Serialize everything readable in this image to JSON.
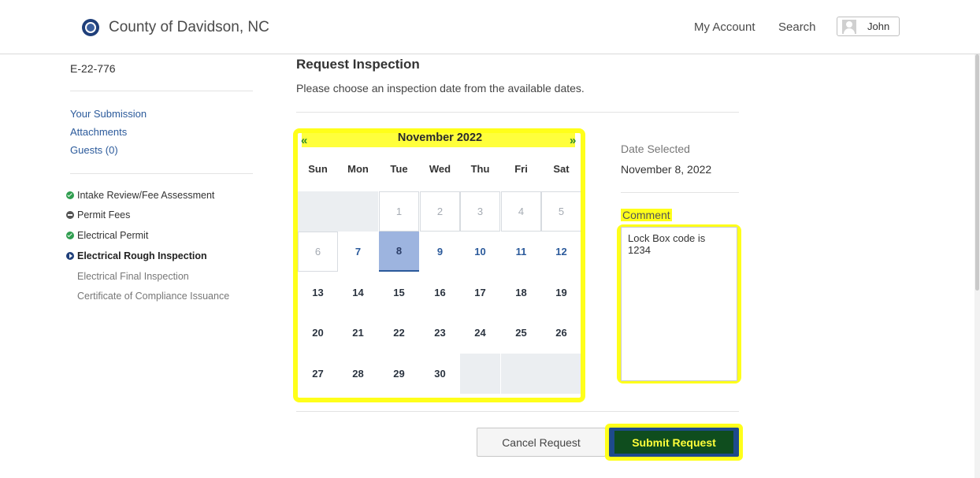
{
  "header": {
    "brand": "County of Davidson, NC",
    "my_account": "My Account",
    "search": "Search",
    "user": "John"
  },
  "sidebar": {
    "record_id": "E-22-776",
    "links": [
      "Your Submission",
      "Attachments",
      "Guests (0)"
    ],
    "steps": [
      {
        "label": "Intake Review/Fee Assessment",
        "status": "complete"
      },
      {
        "label": "Permit Fees",
        "status": "pending"
      },
      {
        "label": "Electrical Permit",
        "status": "complete"
      },
      {
        "label": "Electrical Rough Inspection",
        "status": "current"
      },
      {
        "label": "Electrical Final Inspection",
        "status": "future"
      },
      {
        "label": "Certificate of Compliance Issuance",
        "status": "future"
      }
    ]
  },
  "main": {
    "title": "Request Inspection",
    "subtitle": "Please choose an inspection date from the available dates."
  },
  "calendar": {
    "month_label": "November 2022",
    "prev": "«",
    "next": "»",
    "weekdays": [
      "Sun",
      "Mon",
      "Tue",
      "Wed",
      "Thu",
      "Fri",
      "Sat"
    ],
    "weeks": [
      [
        "",
        "",
        "1",
        "2",
        "3",
        "4",
        "5"
      ],
      [
        "6",
        "7",
        "8",
        "9",
        "10",
        "11",
        "12"
      ],
      [
        "13",
        "14",
        "15",
        "16",
        "17",
        "18",
        "19"
      ],
      [
        "20",
        "21",
        "22",
        "23",
        "24",
        "25",
        "26"
      ],
      [
        "27",
        "28",
        "29",
        "30",
        "",
        "",
        ""
      ]
    ],
    "disabled_days": [
      "1",
      "2",
      "3",
      "4",
      "5",
      "6"
    ],
    "selected_day": "8"
  },
  "details": {
    "date_selected_label": "Date Selected",
    "date_selected_value": "November 8, 2022",
    "comment_label": "Comment",
    "comment_value": "Lock Box code is 1234"
  },
  "actions": {
    "cancel": "Cancel Request",
    "submit": "Submit Request"
  },
  "colors": {
    "accent": "#1e4a8c",
    "highlight": "#ffff1a",
    "success": "#2f9e4f"
  }
}
